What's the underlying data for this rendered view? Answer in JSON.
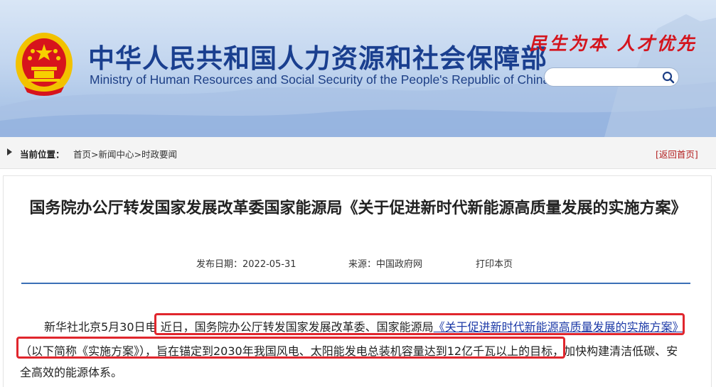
{
  "header": {
    "title_cn": "中华人民共和国人力资源和社会保障部",
    "title_en": "Ministry of Human Resources and Social Security of the People's Republic of China",
    "slogan": "民生为本 人才优先",
    "search_placeholder": "",
    "colors": {
      "title": "#1a3f8f",
      "slogan": "#d4141d"
    }
  },
  "breadcrumb": {
    "label": "当前位置：",
    "items": [
      "首页",
      "新闻中心",
      "时政要闻"
    ],
    "separator": ">",
    "back_home": "[返回首页]"
  },
  "article": {
    "title": "国务院办公厅转发国家发展改革委国家能源局《关于促进新时代新能源高质量发展的实施方案》",
    "publish_date": "发布日期：2022-05-31",
    "source": "来源：中国政府网",
    "print": "打印本页",
    "p1_lead": "新华社北京5月30日电 ",
    "p1_mid": "近日，国务院办公厅转发国家发展改革委、国家能源局",
    "p1_link": "《关于促进新时代新能源高质量发展的实施方案》",
    "p2_highlight": "（以下简称《实施方案》），旨在锚定到2030年我国风电、太阳能发电总装机容量达到12亿千瓦以上的目标，",
    "p2_tail": "加快构建清洁低碳、安",
    "p3": "全高效的能源体系。",
    "highlight_color": "#e0262d"
  }
}
